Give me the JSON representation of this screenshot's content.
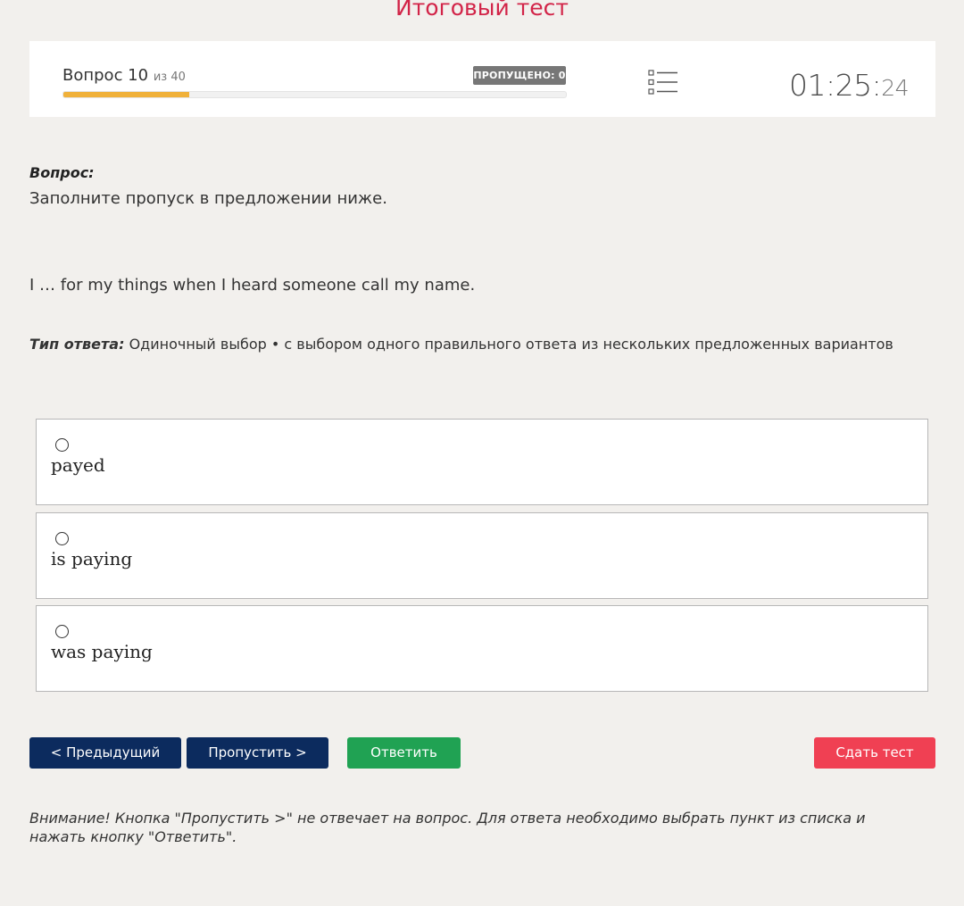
{
  "header": {
    "title": "Итоговый тест"
  },
  "status": {
    "question_label": "Вопрос 10",
    "question_total": "из 40",
    "progress_fraction": 0.25,
    "skipped_badge": "ПРОПУЩЕНО: 0",
    "timer_main": "01:25:",
    "timer_seconds": "24"
  },
  "question": {
    "label": "Вопрос:",
    "instruction": "Заполните пропуск в предложении ниже.",
    "sentence": "I … for my things when I heard someone call my name.",
    "answer_type_label": "Тип ответа:",
    "answer_type_value": "Одиночный выбор • с выбором одного правильного ответа из нескольких предложенных вариантов"
  },
  "options": [
    {
      "label": "payed"
    },
    {
      "label": "is paying"
    },
    {
      "label": "was paying"
    }
  ],
  "buttons": {
    "prev": "< Предыдущий",
    "skip": "Пропустить >",
    "answer": "Ответить",
    "submit": "Сдать тест"
  },
  "note": "Внимание! Кнопка \"Пропустить >\" не отвечает на вопрос. Для ответа необходимо выбрать пункт из списка и нажать кнопку \"Ответить\".",
  "colors": {
    "title": "#d22448",
    "progress": "#f0b13a",
    "nav_button": "#0c2b5e",
    "answer_button": "#20a253",
    "submit_button": "#f04053"
  },
  "icons": {
    "question_list": "list-icon"
  }
}
